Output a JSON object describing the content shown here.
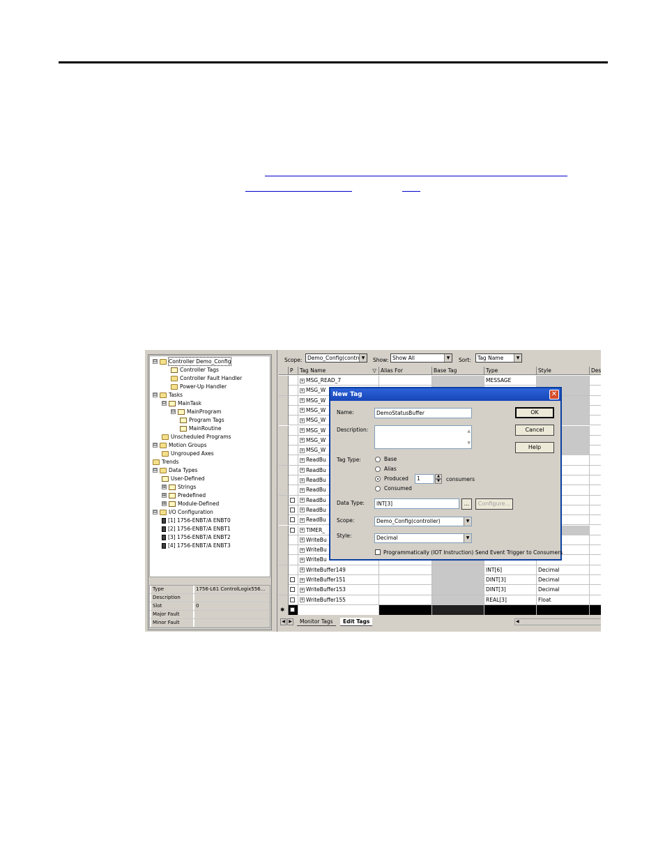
{
  "tree": {
    "items": [
      {
        "label": "Controller Demo_Config",
        "expander": "⊟",
        "icon": "folder-icon"
      },
      {
        "label": "Controller Tags",
        "expander": "",
        "icon": "tag-list-icon"
      },
      {
        "label": "Controller Fault Handler",
        "expander": "",
        "icon": "folder-icon"
      },
      {
        "label": "Power-Up Handler",
        "expander": "",
        "icon": "folder-icon"
      },
      {
        "label": "Tasks",
        "expander": "⊟",
        "icon": "folder-icon"
      },
      {
        "label": "MainTask",
        "expander": "⊟",
        "icon": "task-icon"
      },
      {
        "label": "MainProgram",
        "expander": "⊟",
        "icon": "program-icon"
      },
      {
        "label": "Program Tags",
        "expander": "",
        "icon": "tag-list-icon"
      },
      {
        "label": "MainRoutine",
        "expander": "",
        "icon": "routine-icon"
      },
      {
        "label": "Unscheduled Programs",
        "expander": "",
        "icon": "folder-icon"
      },
      {
        "label": "Motion Groups",
        "expander": "⊟",
        "icon": "folder-icon"
      },
      {
        "label": "Ungrouped Axes",
        "expander": "",
        "icon": "folder-icon"
      },
      {
        "label": "Trends",
        "expander": "",
        "icon": "folder-icon"
      },
      {
        "label": "Data Types",
        "expander": "⊟",
        "icon": "folder-icon"
      },
      {
        "label": "User-Defined",
        "expander": "",
        "icon": "data-type-icon"
      },
      {
        "label": "Strings",
        "expander": "⊞",
        "icon": "data-type-icon"
      },
      {
        "label": "Predefined",
        "expander": "⊞",
        "icon": "data-type-icon"
      },
      {
        "label": "Module-Defined",
        "expander": "⊞",
        "icon": "data-type-icon"
      },
      {
        "label": "I/O Configuration",
        "expander": "⊟",
        "icon": "folder-icon"
      },
      {
        "label": "[1] 1756-ENBT/A ENBT0",
        "expander": "",
        "icon": "module-icon"
      },
      {
        "label": "[2] 1756-ENBT/A ENBT1",
        "expander": "",
        "icon": "module-icon"
      },
      {
        "label": "[3] 1756-ENBT/A ENBT2",
        "expander": "",
        "icon": "module-icon"
      },
      {
        "label": "[4] 1756-ENBT/A ENBT3",
        "expander": "",
        "icon": "module-icon"
      }
    ]
  },
  "properties": [
    {
      "key": "Type",
      "value": "1756-L61 ControlLogix556..."
    },
    {
      "key": "Description",
      "value": ""
    },
    {
      "key": "Slot",
      "value": "0"
    },
    {
      "key": "Major Fault",
      "value": ""
    },
    {
      "key": "Minor Fault",
      "value": ""
    }
  ],
  "toolbar": {
    "scope_label": "Scope:",
    "scope_value": "Demo_Config(contrc",
    "show_label": "Show:",
    "show_value": "Show All",
    "sort_label": "Sort:",
    "sort_value": "Tag Name"
  },
  "grid": {
    "headers": {
      "p": "P",
      "name": "Tag Name",
      "sort_indicator": "▽",
      "alias": "Alias For",
      "base": "Base Tag",
      "type": "Type",
      "style": "Style",
      "desc": "Des"
    },
    "rows": [
      {
        "checkbox": false,
        "name": "MSG_READ_7",
        "type": "MESSAGE",
        "style": "",
        "style_gray": true
      },
      {
        "checkbox": false,
        "name": "MSG_W",
        "type": "",
        "style": "",
        "style_gray": true
      },
      {
        "checkbox": false,
        "name": "MSG_W",
        "type": "",
        "style": "",
        "style_gray": true
      },
      {
        "checkbox": false,
        "name": "MSG_W",
        "type": "",
        "style": "",
        "style_gray": true
      },
      {
        "checkbox": false,
        "name": "MSG_W",
        "type": "",
        "style": "",
        "style_gray": true
      },
      {
        "checkbox": false,
        "name": "MSG_W",
        "type": "",
        "style": "",
        "style_gray": true
      },
      {
        "checkbox": false,
        "name": "MSG_W",
        "type": "",
        "style": "",
        "style_gray": true
      },
      {
        "checkbox": false,
        "name": "MSG_W",
        "type": "",
        "style": "",
        "style_gray": true
      },
      {
        "checkbox": false,
        "name": "ReadBu",
        "type": "",
        "style": "",
        "style_gray": false
      },
      {
        "checkbox": false,
        "name": "ReadBu",
        "type": "",
        "style": "",
        "style_gray": false
      },
      {
        "checkbox": false,
        "name": "ReadBu",
        "type": "",
        "style": "",
        "style_gray": false
      },
      {
        "checkbox": false,
        "name": "ReadBu",
        "type": "",
        "style": "",
        "style_gray": false
      },
      {
        "checkbox": true,
        "name": "ReadBu",
        "type": "",
        "style": "",
        "style_gray": false
      },
      {
        "checkbox": true,
        "name": "ReadBu",
        "type": "",
        "style": "",
        "style_gray": false
      },
      {
        "checkbox": true,
        "name": "ReadBu",
        "type": "",
        "style": "",
        "style_gray": false
      },
      {
        "checkbox": true,
        "name": "TIMER_",
        "type": "",
        "style": "",
        "style_gray": true
      },
      {
        "checkbox": false,
        "name": "WriteBu",
        "type": "",
        "style": "",
        "style_gray": false
      },
      {
        "checkbox": false,
        "name": "WriteBu",
        "type": "",
        "style": "",
        "style_gray": false
      },
      {
        "checkbox": false,
        "name": "WriteBu",
        "type": "",
        "style": "",
        "style_gray": false
      },
      {
        "checkbox": false,
        "name": "WriteBuffer149",
        "type": "INT[6]",
        "style": "Decimal",
        "style_gray": false
      },
      {
        "checkbox": true,
        "name": "WriteBuffer151",
        "type": "DINT[3]",
        "style": "Decimal",
        "style_gray": false
      },
      {
        "checkbox": true,
        "name": "WriteBuffer153",
        "type": "DINT[3]",
        "style": "Decimal",
        "style_gray": false
      },
      {
        "checkbox": true,
        "name": "WriteBuffer155",
        "type": "REAL[3]",
        "style": "Float",
        "style_gray": false
      }
    ],
    "new_row_marker": "✱"
  },
  "tabs": {
    "monitor": "Monitor Tags",
    "edit": "Edit Tags"
  },
  "dialog": {
    "title": "New Tag",
    "close_glyph": "✕",
    "name_label": "Name:",
    "name_value": "DemoStatusBuffer",
    "description_label": "Description:",
    "tag_type_label": "Tag Type:",
    "tag_types": [
      "Base",
      "Alias",
      "Produced",
      "Consumed"
    ],
    "selected_tag_type": "Produced",
    "consumers_value": "1",
    "consumers_label": "consumers",
    "data_type_label": "Data Type:",
    "data_type_value": "INT[3]",
    "browse_label": "...",
    "configure_label": "Configure...",
    "scope_label": "Scope:",
    "scope_value": "Demo_Config(controller)",
    "style_label": "Style:",
    "style_value": "Decimal",
    "iot_label": "Programmatically (IOT Instruction) Send Event Trigger to Consumers",
    "iot_checked": false,
    "ok_label": "OK",
    "cancel_label": "Cancel",
    "help_label": "Help"
  }
}
